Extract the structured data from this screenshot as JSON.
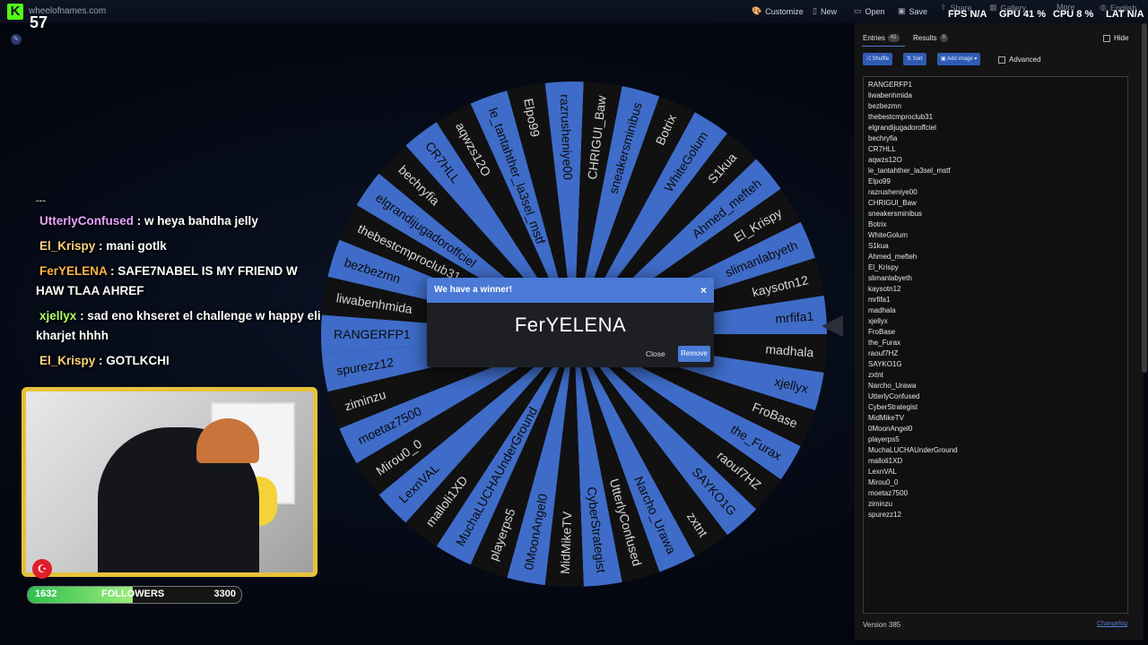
{
  "browser": {
    "site": "wheelofnames.com"
  },
  "stream": {
    "viewer_count": "57",
    "fps_label": "FPS",
    "fps_value": "N/A",
    "gpu_label": "GPU",
    "gpu_value": "41 %",
    "cpu_label": "CPU",
    "cpu_value": "8 %",
    "lat_label": "LAT",
    "lat_value": "N/A"
  },
  "menu": {
    "customize": "Customize",
    "new": "New",
    "open": "Open",
    "save": "Save",
    "share": "Share",
    "gallery": "Gallery",
    "more": "More",
    "language": "English"
  },
  "chat": {
    "separator": "---",
    "messages": [
      {
        "user": "UtterlyConfused",
        "text": ": w heya bahdha jelly",
        "color": "#e6a3ff"
      },
      {
        "user": "El_Krispy",
        "text": ": mani gotlk",
        "color": "#ffd27a"
      },
      {
        "user": "FerYELENA",
        "text": ": SAFE7NABEL IS MY FRIEND W HAW TLAA AHREF",
        "color": "#ffb347"
      },
      {
        "user": "xjellyx",
        "text": ": sad eno khseret el challenge w happy eli kharjet hhhh",
        "color": "#b3ff66"
      },
      {
        "user": "El_Krispy",
        "text": ": GOTLKCHI",
        "color": "#ffd27a"
      }
    ]
  },
  "followers_bar": {
    "current": "1632",
    "label": "FOLLOWERS",
    "goal": "3300",
    "progress": 0.49
  },
  "wheel": {
    "colors": [
      "#3f6cc8",
      "#111111"
    ],
    "text_colors": [
      "#0b0b0b",
      "#d7d7d7"
    ],
    "segments": [
      "RANGERFP1",
      "liwabenhmida",
      "bezbezmn",
      "thebestcmproclub31",
      "elgrandijugadoroffciel",
      "bechryfia",
      "CR7HLL",
      "aqwzs12O",
      "le_tantahther_la3sel_mstf",
      "Elpo99",
      "razrusheniye00",
      "CHRIGUI_Baw",
      "sneakersminibus",
      "Botrix",
      "WhiteGolum",
      "S1kua",
      "Ahmed_mefteh",
      "El_Krispy",
      "slimanlabyeth",
      "kaysotn12",
      "mrfifa1",
      "madhala",
      "xjellyx",
      "FroBase",
      "the_Furax",
      "raouf7HZ",
      "SAYKO1G",
      "zxtnt",
      "Narcho_Urawa",
      "UtterlyConfused",
      "CyberStrategist",
      "MidMikeTV",
      "0MoonAngel0",
      "playerps5",
      "MuchaLUCHAUnderGround",
      "malloli1XD",
      "LexnVAL",
      "Mirou0_0",
      "moetaz7500",
      "ziminzu",
      "spurezz12"
    ]
  },
  "dialog": {
    "title": "We have a winner!",
    "winner": "FerYELENA",
    "close_label": "Close",
    "remove_label": "Remove"
  },
  "panel": {
    "tab_entries": "Entries",
    "entries_count": "41",
    "tab_results": "Results",
    "results_count": "0",
    "hide_label": "Hide",
    "shuffle_label": "Shuffle",
    "sort_label": "Sort",
    "add_image_label": "Add image",
    "advanced_label": "Advanced",
    "entries": [
      "RANGERFP1",
      "liwabenhmida",
      "bezbezmn",
      "thebestcmproclub31",
      "elgrandijugadoroffciel",
      "bechryfia",
      "CR7HLL",
      "aqwzs12O",
      "le_tantahther_la3sel_mstf",
      "Elpo99",
      "razrusheniye00",
      "CHRIGUI_Baw",
      "sneakersminibus",
      "Botrix",
      "WhiteGolum",
      "S1kua",
      "Ahmed_mefteh",
      "El_Krispy",
      "slimanlabyeth",
      "kaysotn12",
      "mrfifa1",
      "madhala",
      "xjellyx",
      "FroBase",
      "the_Furax",
      "raouf7HZ",
      "SAYKO1G",
      "zxtnt",
      "Narcho_Urawa",
      "UtterlyConfused",
      "CyberStrategist",
      "MidMikeTV",
      "0MoonAngel0",
      "playerps5",
      "MuchaLUCHAUnderGround",
      "malloli1XD",
      "LexnVAL",
      "Mirou0_0",
      "moetaz7500",
      "ziminzu",
      "spurezz12"
    ],
    "version": "Version 385",
    "changelog": "Changelog"
  }
}
